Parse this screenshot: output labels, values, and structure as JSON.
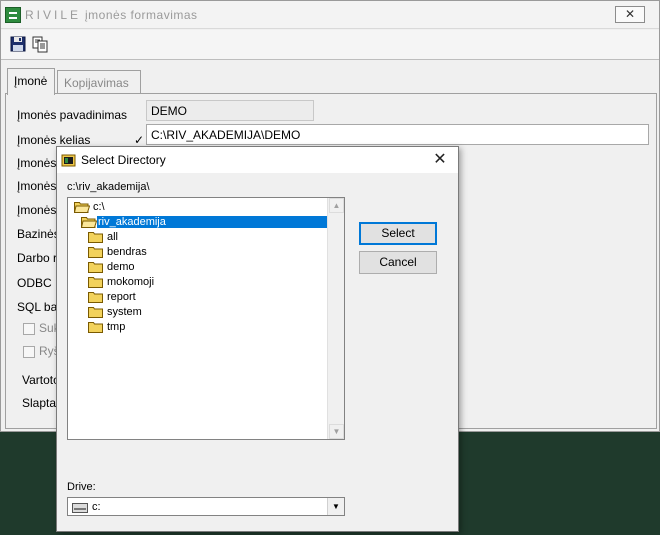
{
  "window": {
    "brand": "RIVILE",
    "title": "įmonės formavimas",
    "close_glyph": "✕"
  },
  "toolbar": {
    "save_icon": "floppy-disk-icon",
    "copy_icon": "copy-pages-icon"
  },
  "tabs": [
    {
      "label": "Įmonė",
      "active": true
    },
    {
      "label": "Kopijavimas",
      "active": false
    }
  ],
  "form": {
    "labels": {
      "company_name": "Įmonės pavadinimas",
      "company_path": "Įmonės kelias",
      "label3": "Įmonės",
      "label4": "Įmonės",
      "label5": "Įmonės",
      "label6": "Bazinės",
      "label7": "Darbo r",
      "label8": "ODBC",
      "label9": "SQL ba",
      "check1": "Suk",
      "check2": "Ryš",
      "label12": "Vartoto",
      "label13": "Slapta"
    },
    "values": {
      "company_name": "DEMO",
      "company_path": "C:\\RIV_AKADEMIJA\\DEMO"
    },
    "check_mark": "✓"
  },
  "dialog": {
    "title": "Select Directory",
    "close_glyph": "✕",
    "current_path": "c:\\riv_akademija\\",
    "tree": [
      {
        "label": "c:\\",
        "level": 0,
        "open": true,
        "selected": false
      },
      {
        "label": "riv_akademija",
        "level": 1,
        "open": true,
        "selected": true
      },
      {
        "label": "all",
        "level": 2,
        "open": false,
        "selected": false
      },
      {
        "label": "bendras",
        "level": 2,
        "open": false,
        "selected": false
      },
      {
        "label": "demo",
        "level": 2,
        "open": false,
        "selected": false
      },
      {
        "label": "mokomoji",
        "level": 2,
        "open": false,
        "selected": false
      },
      {
        "label": "report",
        "level": 2,
        "open": false,
        "selected": false
      },
      {
        "label": "system",
        "level": 2,
        "open": false,
        "selected": false
      },
      {
        "label": "tmp",
        "level": 2,
        "open": false,
        "selected": false
      }
    ],
    "select_label": "Select",
    "cancel_label": "Cancel",
    "drive_label": "Drive:",
    "drive_value": "c:",
    "colors": {
      "selection": "#0078d7",
      "folder": "#f2d25c"
    }
  }
}
